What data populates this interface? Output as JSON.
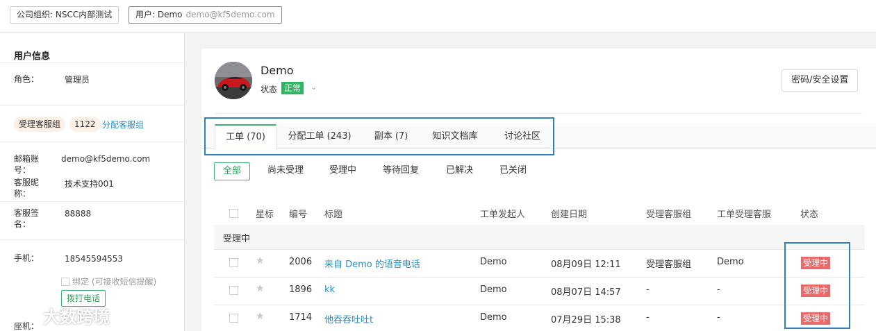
{
  "topbar": {
    "org_tag": "公司组织: NSCC内部测试",
    "user_prefix": "用户: Demo",
    "user_email": "demo@kf5demo.com"
  },
  "user_info": {
    "title": "用户信息",
    "role_label": "角色：",
    "role_value": "管理员",
    "group_pill": "受理客服组",
    "group_count": "1122",
    "assign_link": "分配客服组",
    "email_label": "邮箱账号：",
    "email_value": "demo@kf5demo.com",
    "nickname_label": "客服昵称：",
    "nickname_value": "技术支持001",
    "signature_label": "客服签名：",
    "signature_value": "88888",
    "phone_label": "手机：",
    "phone_value": "18545594553",
    "bind_label": "绑定 (可接收短信提醒)",
    "call_button": "拨打电话",
    "landline_label": "座机："
  },
  "profile": {
    "name": "Demo",
    "status_label": "状态",
    "status_value": "正常",
    "caret": "⌄",
    "password_button": "密码/安全设置"
  },
  "tabs": [
    {
      "label": "工单 (70)",
      "active": true
    },
    {
      "label": "分配工单 (243)",
      "active": false
    },
    {
      "label": "副本 (7)",
      "active": false
    },
    {
      "label": "知识文档库",
      "active": false
    },
    {
      "label": "讨论社区",
      "active": false
    }
  ],
  "filters": [
    {
      "label": "全部",
      "active": true
    },
    {
      "label": "尚未受理",
      "active": false
    },
    {
      "label": "受理中",
      "active": false
    },
    {
      "label": "等待回复",
      "active": false
    },
    {
      "label": "已解决",
      "active": false
    },
    {
      "label": "已关闭",
      "active": false
    }
  ],
  "table": {
    "headers": {
      "star": "星标",
      "id": "编号",
      "title": "标题",
      "requester": "工单发起人",
      "created": "创建日期",
      "group": "受理客服组",
      "assignee": "工单受理客服",
      "status": "状态"
    },
    "group_label": "受理中",
    "rows": [
      {
        "id": "2006",
        "title": "来自 Demo 的语音电话",
        "requester": "Demo",
        "created": "08月09日 12:11",
        "group": "受理客服组",
        "assignee": "Demo",
        "status": "受理中"
      },
      {
        "id": "1896",
        "title": "kk",
        "requester": "Demo",
        "created": "08月07日 14:57",
        "group": "-",
        "assignee": "-",
        "status": "受理中"
      },
      {
        "id": "1714",
        "title": "他吞吞吐吐t",
        "requester": "Demo",
        "created": "07月29日 15:38",
        "group": "-",
        "assignee": "-",
        "status": "受理中"
      }
    ]
  },
  "watermark": "大数跨境",
  "colors": {
    "accent_green": "#3cb371",
    "link_blue": "#2a8fc1",
    "status_red": "#ea6a6a",
    "highlight_blue": "#2f7fc1"
  }
}
